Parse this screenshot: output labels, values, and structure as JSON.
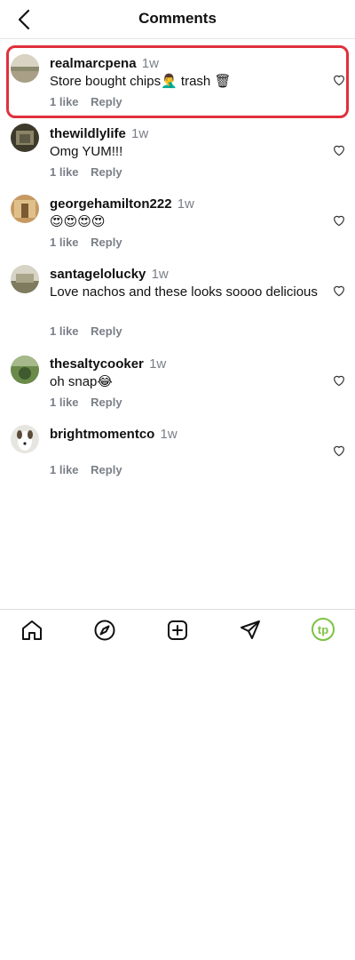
{
  "header": {
    "title": "Comments",
    "back_icon": "chevron-left-icon"
  },
  "comments": [
    {
      "username": "realmarcpena",
      "time": "1w",
      "text": "Store bought chips🤦‍♂️ trash 🗑",
      "likes": "1 like",
      "reply": "Reply",
      "selected": true
    },
    {
      "username": "thewildlylife",
      "time": "1w",
      "text": "Omg YUM!!!",
      "likes": "1 like",
      "reply": "Reply"
    },
    {
      "username": "georgehamilton222",
      "time": "1w",
      "text": "😍😍😍😍",
      "likes": "1 like",
      "reply": "Reply"
    },
    {
      "username": "santagelolucky",
      "time": "1w",
      "text": "Love nachos and these looks soooo delicious",
      "likes": "1 like",
      "reply": "Reply"
    },
    {
      "username": "thesaltycooker",
      "time": "1w",
      "text": "oh snap😂",
      "likes": "1 like",
      "reply": "Reply"
    },
    {
      "username": "brightmomentco",
      "time": "1w",
      "text": "",
      "likes": "1 like",
      "reply": "Reply"
    }
  ],
  "tabbar": {
    "items": [
      "home-icon",
      "explore-compass-icon",
      "create-post-icon",
      "direct-message-icon",
      "profile-avatar-icon"
    ],
    "profile_initials": "tp",
    "accent": "#7cc242"
  },
  "colors": {
    "highlight": "#e0303d",
    "muted": "#7a7f87"
  }
}
